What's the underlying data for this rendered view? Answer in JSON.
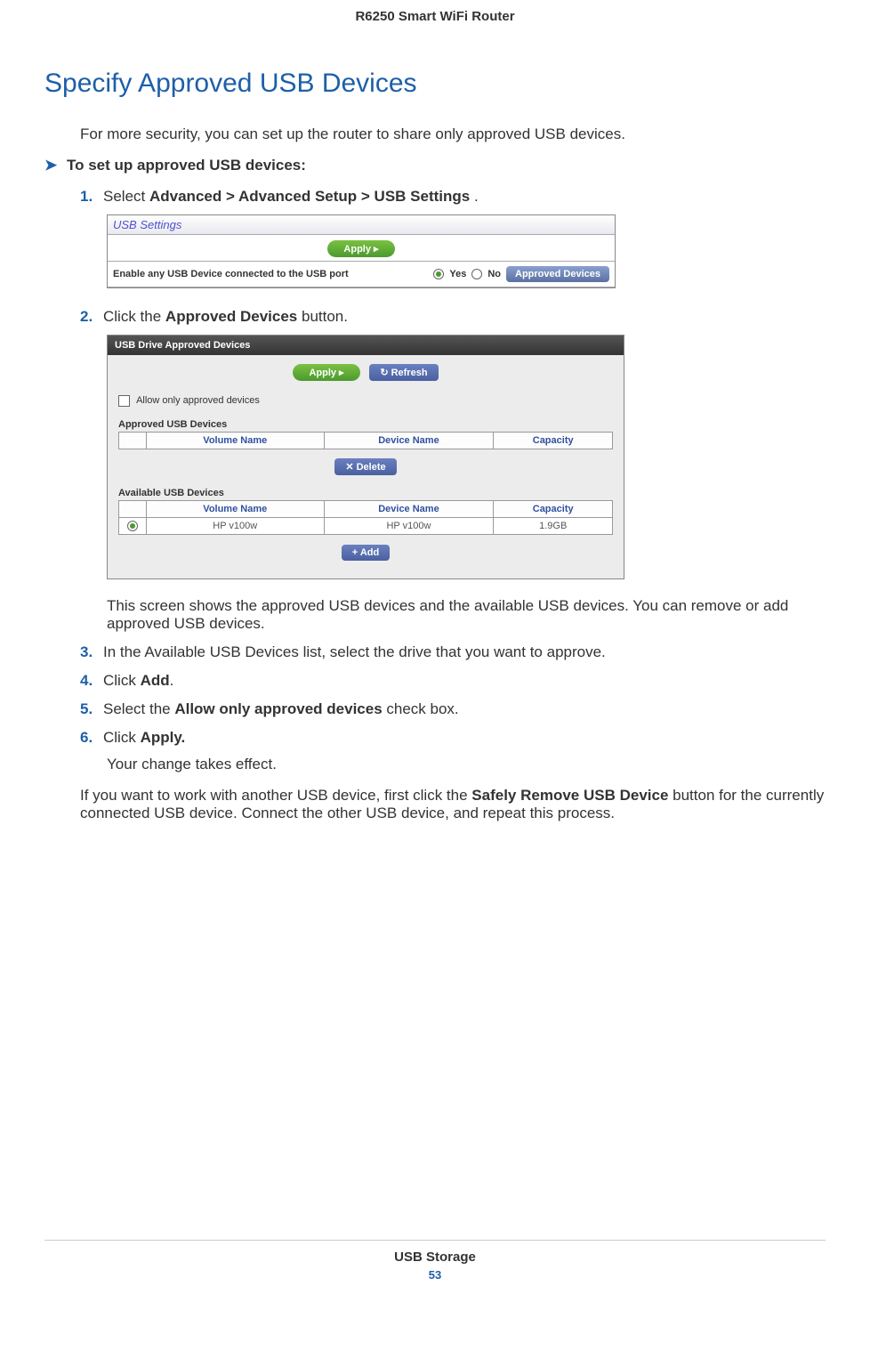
{
  "header": {
    "title": "R6250 Smart WiFi Router"
  },
  "section": {
    "title": "Specify Approved USB Devices"
  },
  "intro": "For more security, you can set up the router to share only approved USB devices.",
  "task_heading": "To set up approved USB devices:",
  "steps": {
    "s1": {
      "num": "1.",
      "pre": "Select ",
      "bold": "Advanced > Advanced Setup > USB Settings",
      "post": " ."
    },
    "s2": {
      "num": "2.",
      "pre": "Click the ",
      "bold": "Approved Devices",
      "post": " button."
    },
    "s2_body": "This screen shows the approved USB devices and the available USB devices. You can remove or add approved USB devices.",
    "s3": {
      "num": "3.",
      "text": "In the Available USB Devices list, select the drive that you want to approve."
    },
    "s4": {
      "num": "4.",
      "pre": "Click ",
      "bold": "Add",
      "post": "."
    },
    "s5": {
      "num": "5.",
      "pre": "Select the ",
      "bold": "Allow only approved devices",
      "post": " check box."
    },
    "s6": {
      "num": "6.",
      "pre": "Click ",
      "bold": "Apply.",
      "post": ""
    },
    "s6_body": "Your change takes effect."
  },
  "trailing": {
    "pre": "If you want to work with another USB device, first click the ",
    "bold": "Safely Remove USB Device",
    "post": " button for the currently connected USB device. Connect the other USB device, and repeat this process."
  },
  "ss1": {
    "title": "USB Settings",
    "apply": "Apply   ▸",
    "row_label": "Enable any USB Device connected to the USB port",
    "yes": "Yes",
    "no": "No",
    "approved_btn": "Approved Devices"
  },
  "ss2": {
    "title": "USB Drive Approved Devices",
    "apply": "Apply ▸",
    "refresh": "↻ Refresh",
    "check_label": "Allow only approved devices",
    "h_approved": "Approved USB Devices",
    "h_available": "Available USB Devices",
    "col_vol": "Volume Name",
    "col_dev": "Device Name",
    "col_cap": "Capacity",
    "delete": "✕ Delete",
    "add": "+ Add",
    "row_vol": "HP v100w",
    "row_dev": "HP v100w",
    "row_cap": "1.9GB"
  },
  "footer": {
    "section": "USB Storage",
    "page": "53"
  }
}
